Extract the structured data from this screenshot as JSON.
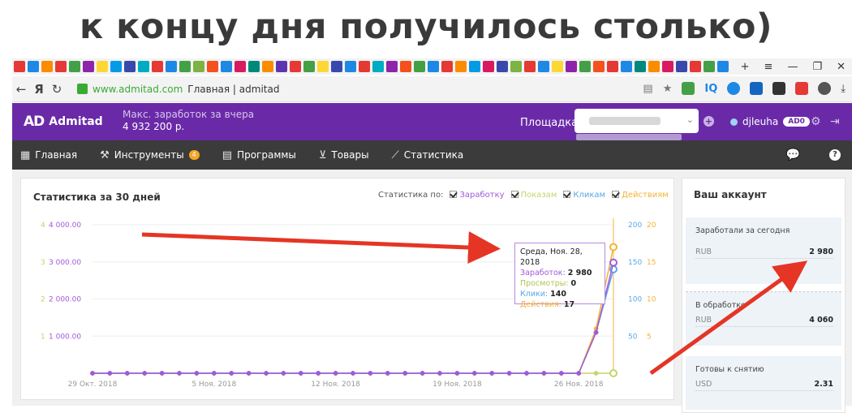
{
  "caption": "к концу дня получилось столько)",
  "browser": {
    "url_domain": "www.admitad.com",
    "page_title": "Главная | admitad",
    "bookmark_colors": [
      "#e53935",
      "#1e88e5",
      "#fb8c00",
      "#e53935",
      "#43a047",
      "#8e24aa",
      "#fdd835",
      "#039be5",
      "#3949ab",
      "#00acc1",
      "#e53935",
      "#1e88e5",
      "#43a047",
      "#7cb342",
      "#f4511e",
      "#1e88e5",
      "#d81b60",
      "#00897b",
      "#fb8c00",
      "#5e35b1",
      "#e53935",
      "#43a047",
      "#fdd835",
      "#3949ab",
      "#1e88e5",
      "#e53935",
      "#00acc1",
      "#8e24aa",
      "#f4511e",
      "#43a047",
      "#1e88e5",
      "#e53935",
      "#fb8c00",
      "#039be5",
      "#d81b60",
      "#3949ab",
      "#7cb342",
      "#e53935",
      "#1e88e5",
      "#fdd835",
      "#8e24aa",
      "#43a047",
      "#f4511e",
      "#e53935",
      "#1e88e5",
      "#00897b",
      "#fb8c00",
      "#d81b60",
      "#3949ab",
      "#e53935",
      "#43a047",
      "#1e88e5"
    ]
  },
  "header": {
    "logo": "Admitad",
    "logo_mark": "AD",
    "max_earn_label": "Макс. заработок за вчера",
    "max_earn_value": "4 932 200 р.",
    "platform_label": "Площадка:",
    "username": "djleuha",
    "user_badge": "AD0"
  },
  "menu": {
    "home": "Главная",
    "tools": "Инструменты",
    "tools_count": "4",
    "programs": "Программы",
    "products": "Товары",
    "stats": "Статистика"
  },
  "stats_panel": {
    "title": "Статистика за 30 дней",
    "stats_by": "Статистика по:",
    "opt_earn": "Заработку",
    "opt_views": "Показам",
    "opt_clicks": "Кликам",
    "opt_actions": "Действиям"
  },
  "tooltip": {
    "date": "Среда, Ноя. 28, 2018",
    "earn_label": "Заработок:",
    "earn_value": "2 980",
    "views_label": "Просмотры:",
    "views_value": "0",
    "clicks_label": "Клики:",
    "clicks_value": "140",
    "actions_label": "Действия:",
    "actions_value": "17"
  },
  "chart_data": {
    "type": "line",
    "x_tick_labels": [
      "29 Окт. 2018",
      "5 Ноя. 2018",
      "12 Ноя. 2018",
      "19 Ноя. 2018",
      "26 Ноя. 2018"
    ],
    "x": [
      "2018-10-29",
      "2018-10-30",
      "2018-10-31",
      "2018-11-01",
      "2018-11-02",
      "2018-11-03",
      "2018-11-04",
      "2018-11-05",
      "2018-11-06",
      "2018-11-07",
      "2018-11-08",
      "2018-11-09",
      "2018-11-10",
      "2018-11-11",
      "2018-11-12",
      "2018-11-13",
      "2018-11-14",
      "2018-11-15",
      "2018-11-16",
      "2018-11-17",
      "2018-11-18",
      "2018-11-19",
      "2018-11-20",
      "2018-11-21",
      "2018-11-22",
      "2018-11-23",
      "2018-11-24",
      "2018-11-25",
      "2018-11-26",
      "2018-11-27",
      "2018-11-28"
    ],
    "axes": {
      "left_actions": {
        "ticks": [
          "4",
          "3",
          "2",
          "1"
        ],
        "range": [
          0,
          4
        ],
        "color": "#c5d36b"
      },
      "left_earn": {
        "ticks": [
          "4 000.00",
          "3 000.00",
          "2 000.00",
          "1 000.00"
        ],
        "range": [
          0,
          4000
        ],
        "color": "#a259d9"
      },
      "right_clicks": {
        "ticks": [
          "200",
          "150",
          "100",
          "50"
        ],
        "range": [
          0,
          200
        ],
        "color": "#5aa7e6"
      },
      "right_actions": {
        "ticks": [
          "20",
          "15",
          "10",
          "5"
        ],
        "range": [
          0,
          20
        ],
        "color": "#f5b335"
      }
    },
    "series": [
      {
        "name": "Заработку",
        "axis": "left_earn",
        "color": "#a259d9",
        "values": [
          0,
          0,
          0,
          0,
          0,
          0,
          0,
          0,
          0,
          0,
          0,
          0,
          0,
          0,
          0,
          0,
          0,
          0,
          0,
          0,
          0,
          0,
          0,
          0,
          0,
          0,
          0,
          0,
          0,
          1100,
          2980
        ]
      },
      {
        "name": "Показам",
        "axis": "left_actions",
        "color": "#c5d36b",
        "values": [
          0,
          0,
          0,
          0,
          0,
          0,
          0,
          0,
          0,
          0,
          0,
          0,
          0,
          0,
          0,
          0,
          0,
          0,
          0,
          0,
          0,
          0,
          0,
          0,
          0,
          0,
          0,
          0,
          0,
          0,
          0
        ]
      },
      {
        "name": "Кликам",
        "axis": "right_clicks",
        "color": "#5aa7e6",
        "values": [
          0,
          0,
          0,
          0,
          0,
          0,
          0,
          0,
          0,
          0,
          0,
          0,
          0,
          0,
          0,
          0,
          0,
          0,
          0,
          0,
          0,
          0,
          0,
          0,
          0,
          0,
          0,
          0,
          0,
          55,
          140
        ]
      },
      {
        "name": "Действиям",
        "axis": "right_actions",
        "color": "#f5b335",
        "values": [
          0,
          0,
          0,
          0,
          0,
          0,
          0,
          0,
          0,
          0,
          0,
          0,
          0,
          0,
          0,
          0,
          0,
          0,
          0,
          0,
          0,
          0,
          0,
          0,
          0,
          0,
          0,
          0,
          0,
          6,
          17
        ]
      }
    ]
  },
  "account": {
    "title": "Ваш аккаунт",
    "today_label": "Заработали за сегодня",
    "today_currency": "RUB",
    "today_value": "2 980",
    "processing_label": "В обработке",
    "processing_currency": "RUB",
    "processing_value": "4 060",
    "withdraw_label": "Готовы к снятию",
    "withdraw_currency": "USD",
    "withdraw_value": "2.31"
  }
}
